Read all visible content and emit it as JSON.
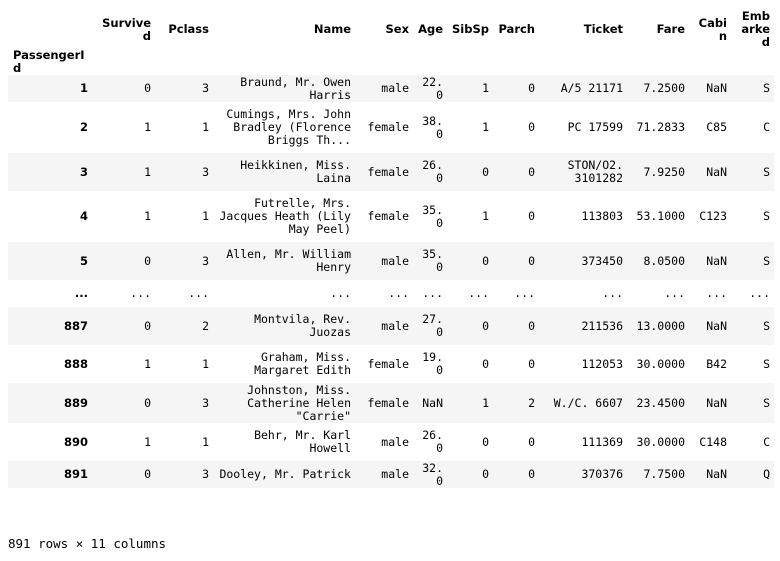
{
  "table": {
    "index_name": "PassengerId",
    "columns": [
      "Survived",
      "Pclass",
      "Name",
      "Sex",
      "Age",
      "SibSp",
      "Parch",
      "Ticket",
      "Fare",
      "Cabin",
      "Embarked"
    ],
    "rows": [
      {
        "index": "1",
        "cells": [
          "0",
          "3",
          "Braund, Mr. Owen Harris",
          "male",
          "22.0",
          "1",
          "0",
          "A/5 21171",
          "7.2500",
          "NaN",
          "S"
        ]
      },
      {
        "index": "2",
        "cells": [
          "1",
          "1",
          "Cumings, Mrs. John Bradley (Florence Briggs Th...",
          "female",
          "38.0",
          "1",
          "0",
          "PC 17599",
          "71.2833",
          "C85",
          "C"
        ]
      },
      {
        "index": "3",
        "cells": [
          "1",
          "3",
          "Heikkinen, Miss. Laina",
          "female",
          "26.0",
          "0",
          "0",
          "STON/O2. 3101282",
          "7.9250",
          "NaN",
          "S"
        ]
      },
      {
        "index": "4",
        "cells": [
          "1",
          "1",
          "Futrelle, Mrs. Jacques Heath (Lily May Peel)",
          "female",
          "35.0",
          "1",
          "0",
          "113803",
          "53.1000",
          "C123",
          "S"
        ]
      },
      {
        "index": "5",
        "cells": [
          "0",
          "3",
          "Allen, Mr. William Henry",
          "male",
          "35.0",
          "0",
          "0",
          "373450",
          "8.0500",
          "NaN",
          "S"
        ]
      },
      {
        "index": "...",
        "cells": [
          "...",
          "...",
          "...",
          "...",
          "...",
          "...",
          "...",
          "...",
          "...",
          "...",
          "..."
        ]
      },
      {
        "index": "887",
        "cells": [
          "0",
          "2",
          "Montvila, Rev. Juozas",
          "male",
          "27.0",
          "0",
          "0",
          "211536",
          "13.0000",
          "NaN",
          "S"
        ]
      },
      {
        "index": "888",
        "cells": [
          "1",
          "1",
          "Graham, Miss. Margaret Edith",
          "female",
          "19.0",
          "0",
          "0",
          "112053",
          "30.0000",
          "B42",
          "S"
        ]
      },
      {
        "index": "889",
        "cells": [
          "0",
          "3",
          "Johnston, Miss. Catherine Helen \"Carrie\"",
          "female",
          "NaN",
          "1",
          "2",
          "W./C. 6607",
          "23.4500",
          "NaN",
          "S"
        ]
      },
      {
        "index": "890",
        "cells": [
          "1",
          "1",
          "Behr, Mr. Karl Howell",
          "male",
          "26.0",
          "0",
          "0",
          "111369",
          "30.0000",
          "C148",
          "C"
        ]
      },
      {
        "index": "891",
        "cells": [
          "0",
          "3",
          "Dooley, Mr. Patrick",
          "male",
          "32.0",
          "0",
          "0",
          "370376",
          "7.7500",
          "NaN",
          "Q"
        ]
      }
    ]
  },
  "footer": {
    "shape_text": "891 rows × 11 columns"
  }
}
